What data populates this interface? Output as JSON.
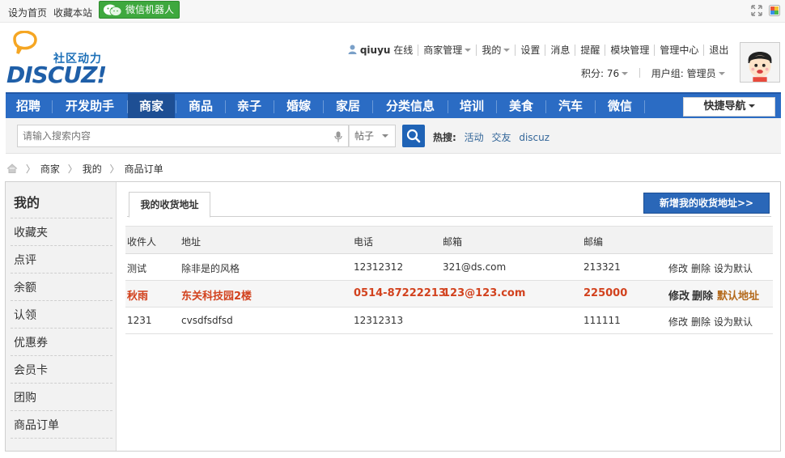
{
  "topbar": {
    "set_home": "设为首页",
    "bookmark": "收藏本站",
    "wechat_robot": "微信机器人"
  },
  "logo": {
    "subtitle": "社区动力",
    "wordmark": "DISCUZ!"
  },
  "user": {
    "name": "qiuyu",
    "status": "在线",
    "menu": [
      "商家管理",
      "我的",
      "设置",
      "消息",
      "提醒",
      "模块管理",
      "管理中心",
      "退出"
    ],
    "points_label": "积分: 76",
    "group_label": "用户组: 管理员"
  },
  "nav": {
    "items": [
      "招聘",
      "开发助手",
      "商家",
      "商品",
      "亲子",
      "婚嫁",
      "家居",
      "分类信息",
      "培训",
      "美食",
      "汽车",
      "微信"
    ],
    "active": "商家",
    "quick_nav": "快捷导航"
  },
  "search": {
    "placeholder": "请输入搜索内容",
    "type": "帖子",
    "hot_label": "热搜:",
    "hot_words": [
      "活动",
      "交友",
      "discuz"
    ]
  },
  "breadcrumb": [
    "商家",
    "我的",
    "商品订单"
  ],
  "sidebar": {
    "title": "我的",
    "items": [
      "收藏夹",
      "点评",
      "余额",
      "认领",
      "优惠券",
      "会员卡",
      "团购",
      "商品订单"
    ]
  },
  "main": {
    "tab": "我的收货地址",
    "new_button": "新增我的收货地址>>",
    "columns": [
      "收件人",
      "地址",
      "电话",
      "邮箱",
      "邮编"
    ],
    "rows": [
      {
        "name": "测试",
        "address": "除非是的风格",
        "phone": "12312312",
        "email": "321@ds.com",
        "zip": "213321",
        "edit": "修改",
        "delete": "删除",
        "default": "设为默认"
      },
      {
        "name": "秋雨",
        "address": "东关科技园2楼",
        "phone": "0514-87222213",
        "email": "123@123.com",
        "zip": "225000",
        "edit": "修改",
        "delete": "删除",
        "default": "默认地址"
      },
      {
        "name": "1231",
        "address": "cvsdfsdfsd",
        "phone": "12312313",
        "email": "",
        "zip": "111111",
        "edit": "修改",
        "delete": "删除",
        "default": "设为默认"
      }
    ]
  }
}
